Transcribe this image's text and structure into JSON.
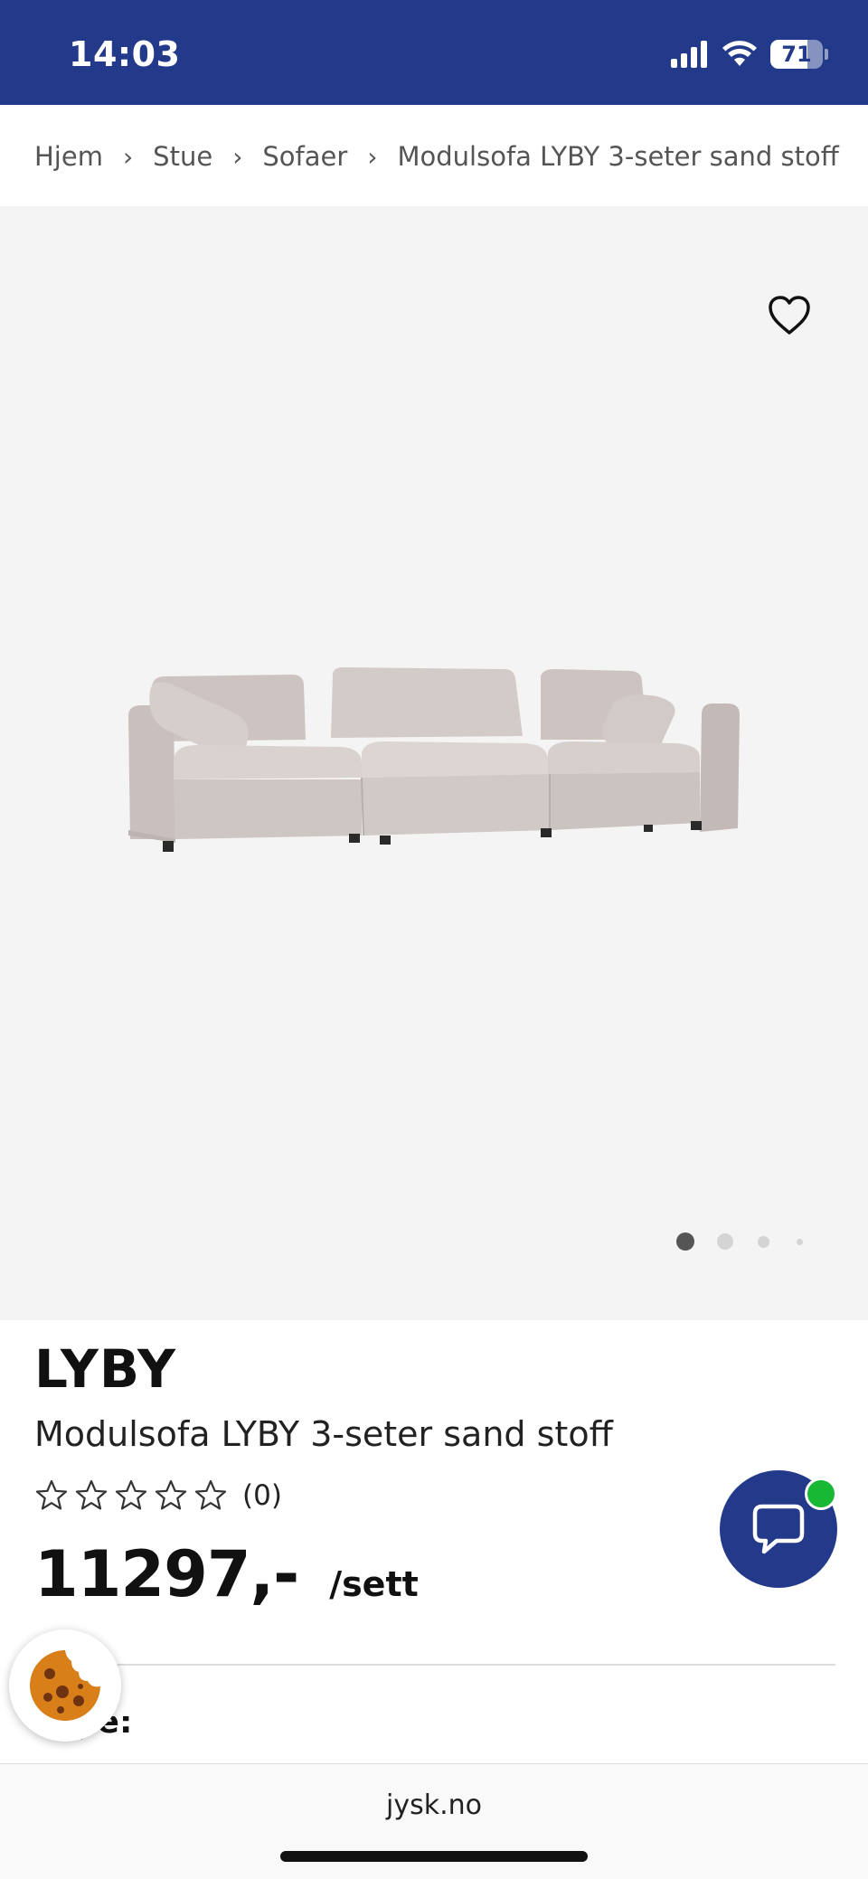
{
  "status_bar": {
    "time": "14:03",
    "battery": "71",
    "battery_level": 0.71,
    "icons": [
      "cellular-signal-icon",
      "wifi-icon",
      "battery-icon"
    ],
    "background": "#23398a"
  },
  "breadcrumb": {
    "items": [
      "Hjem",
      "Stue",
      "Sofaer",
      "Modulsofa LYBY 3-seter sand stoff"
    ],
    "separator": "›"
  },
  "gallery": {
    "image": "sofa-image",
    "image_count": 4,
    "active_index": 0,
    "favorite_icon": "heart-outline-icon"
  },
  "product": {
    "brand": "LYBY",
    "name": "Modulsofa LYBY 3-seter sand stoff",
    "rating": {
      "stars": 0,
      "max": 5,
      "count_label": "(0)"
    },
    "price": "11297,-",
    "price_unit": "/sett",
    "type_label": "Type:"
  },
  "chat": {
    "icon": "chat-bubble-icon",
    "status_color": "#18b834",
    "color": "#23398a"
  },
  "cookie": {
    "icon": "cookie-icon"
  },
  "browser": {
    "url": "jysk.no"
  }
}
